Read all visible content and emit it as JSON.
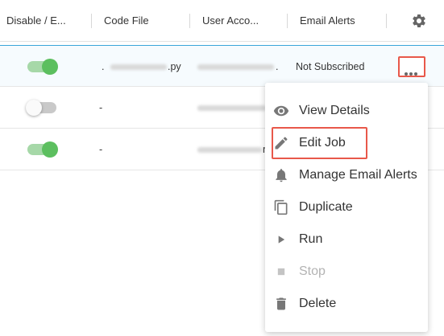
{
  "columns": {
    "disable_enable": "Disable / E...",
    "code_file": "Code File",
    "user_account": "User Acco...",
    "email_alerts": "Email Alerts"
  },
  "rows": [
    {
      "enabled": true,
      "code_file": ".",
      "code_suffix": ".py",
      "user_prefix": "",
      "user_suffix": ".",
      "email_alerts": "Not Subscribed"
    },
    {
      "enabled": false,
      "code_file": "-",
      "code_suffix": "",
      "user_prefix": "",
      "user_suffix": "",
      "email_alerts": ""
    },
    {
      "enabled": true,
      "code_file": "-",
      "code_suffix": "",
      "user_prefix": "",
      "user_suffix": "r",
      "email_alerts": ""
    }
  ],
  "icons": {
    "settings": "gear-icon",
    "more": "more-horizontal-icon",
    "view": "eye-icon",
    "edit": "pencil-icon",
    "alerts": "bell-icon",
    "duplicate": "copy-icon",
    "run": "play-icon",
    "stop": "stop-icon",
    "delete": "trash-icon"
  },
  "menu": {
    "items": [
      {
        "label": "View Details",
        "disabled": false
      },
      {
        "label": "Edit Job",
        "disabled": false
      },
      {
        "label": "Manage Email Alerts",
        "disabled": false
      },
      {
        "label": "Duplicate",
        "disabled": false
      },
      {
        "label": "Run",
        "disabled": false
      },
      {
        "label": "Stop",
        "disabled": true
      },
      {
        "label": "Delete",
        "disabled": false
      }
    ]
  },
  "colors": {
    "toggle_on": "#5cbf5f",
    "highlight": "#e8584a",
    "selected_row_border": "#3aa6d9"
  }
}
